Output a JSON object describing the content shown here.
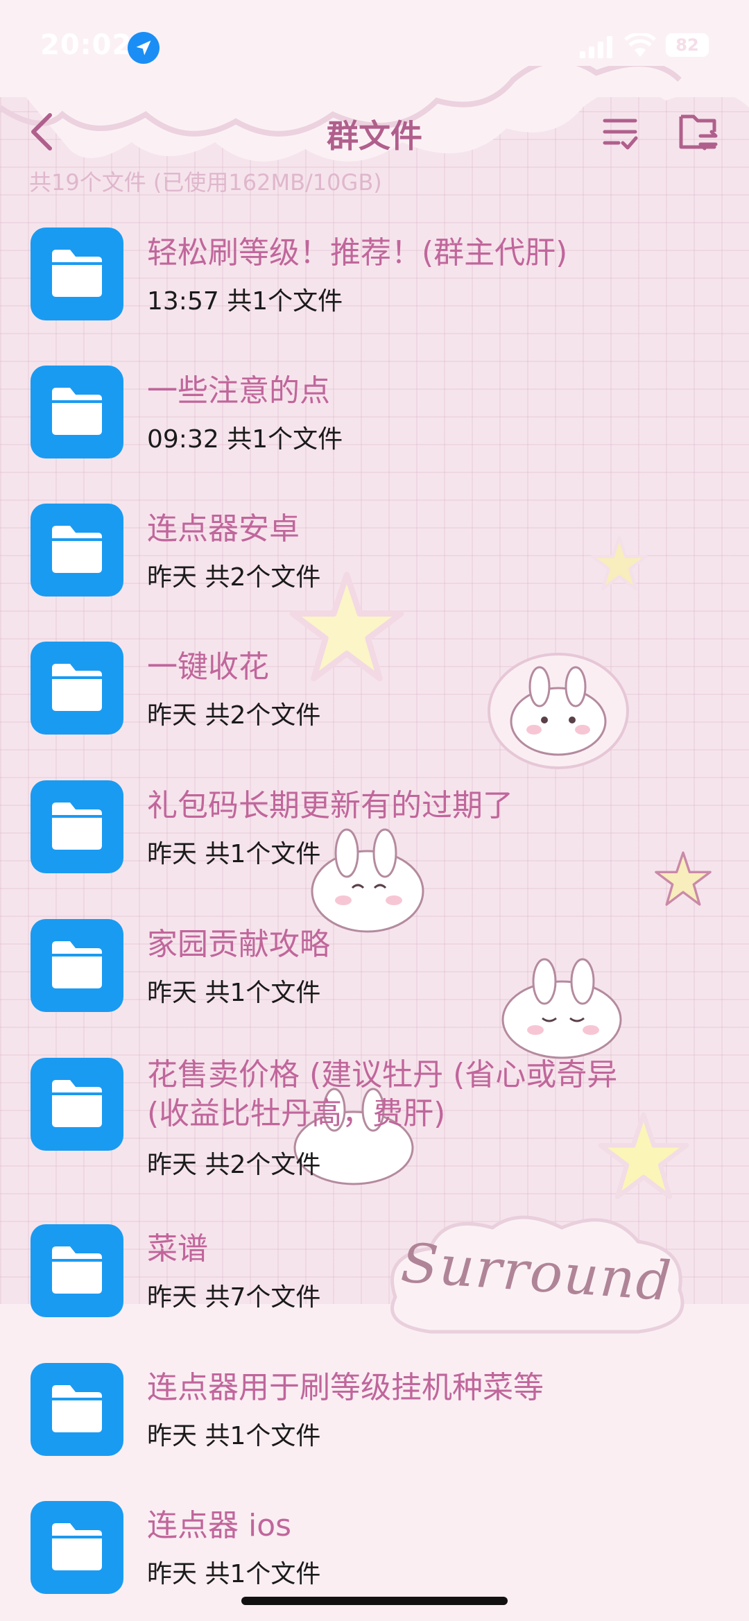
{
  "status_bar": {
    "time": "20:02",
    "battery": "82"
  },
  "header": {
    "title": "群文件",
    "summary": "共19个文件 (已使用162MB/10GB)"
  },
  "files": [
    {
      "name": "轻松刷等级！推荐！(群主代肝)",
      "meta": "13:57 共1个文件"
    },
    {
      "name": "一些注意的点",
      "meta": "09:32 共1个文件"
    },
    {
      "name": "连点器安卓",
      "meta": "昨天 共2个文件"
    },
    {
      "name": "一键收花",
      "meta": "昨天 共2个文件"
    },
    {
      "name": "礼包码长期更新有的过期了",
      "meta": "昨天 共1个文件"
    },
    {
      "name": "家园贡献攻略",
      "meta": "昨天 共1个文件"
    },
    {
      "name": "花售卖价格 (建议牡丹 (省心或奇异 (收益比牡丹高，费肝)",
      "meta": "昨天 共2个文件"
    },
    {
      "name": "菜谱",
      "meta": "昨天 共7个文件"
    },
    {
      "name": "连点器用于刷等级挂机种菜等",
      "meta": "昨天 共1个文件"
    },
    {
      "name": "连点器 ios",
      "meta": "昨天 共1个文件"
    }
  ],
  "decoration": {
    "sticker_text": "Surround"
  },
  "colors": {
    "accent": "#b05f8c",
    "folder": "#1a9bf2",
    "background": "#f6e4ec"
  },
  "icons": [
    "location-arrow-icon",
    "signal-icon",
    "wifi-icon",
    "battery-icon",
    "back-icon",
    "sort-icon",
    "folder-switch-icon",
    "folder-icon"
  ]
}
